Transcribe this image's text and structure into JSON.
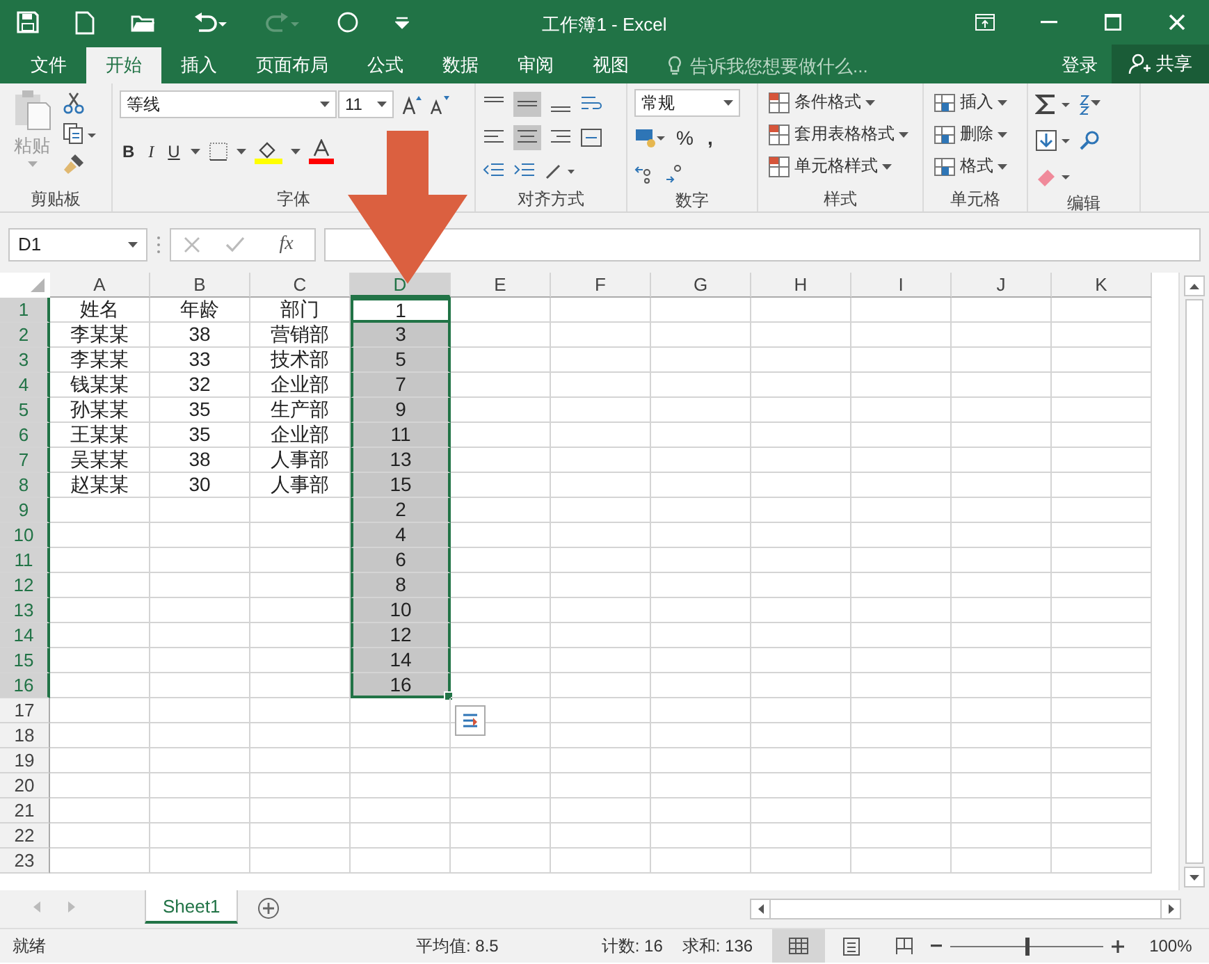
{
  "window": {
    "title": "工作簿1 - Excel"
  },
  "tabs": [
    {
      "label": "文件",
      "selected": false
    },
    {
      "label": "开始",
      "selected": true
    },
    {
      "label": "插入",
      "selected": false
    },
    {
      "label": "页面布局",
      "selected": false
    },
    {
      "label": "公式",
      "selected": false
    },
    {
      "label": "数据",
      "selected": false
    },
    {
      "label": "审阅",
      "selected": false
    },
    {
      "label": "视图",
      "selected": false
    }
  ],
  "tell_me": {
    "placeholder": "告诉我您想要做什么..."
  },
  "sign_in": "登录",
  "share": "共享",
  "ribbon": {
    "clipboard": {
      "paste": "粘贴",
      "label": "剪贴板"
    },
    "font": {
      "name": "等线",
      "size": "11",
      "bold": "B",
      "italic": "I",
      "underline": "U",
      "label": "字体"
    },
    "alignment": {
      "label": "对齐方式"
    },
    "number": {
      "format": "常规",
      "percent": "%",
      "comma": ",",
      "label": "数字"
    },
    "styles": {
      "items": [
        "条件格式",
        "套用表格格式",
        "单元格样式"
      ],
      "label": "样式"
    },
    "cells": {
      "items": [
        "插入",
        "删除",
        "格式"
      ],
      "label": "单元格"
    },
    "editing": {
      "label": "编辑"
    }
  },
  "formula_bar": {
    "name_box": "D1",
    "fx": "fx"
  },
  "columns": [
    {
      "label": "A",
      "selected": false
    },
    {
      "label": "B",
      "selected": false
    },
    {
      "label": "C",
      "selected": false
    },
    {
      "label": "D",
      "selected": true
    },
    {
      "label": "E",
      "selected": false
    },
    {
      "label": "F",
      "selected": false
    },
    {
      "label": "G",
      "selected": false
    },
    {
      "label": "H",
      "selected": false
    },
    {
      "label": "I",
      "selected": false
    },
    {
      "label": "J",
      "selected": false
    },
    {
      "label": "K",
      "selected": false
    }
  ],
  "rows": [
    {
      "number": "1",
      "selected": true,
      "active": true,
      "cells": [
        "姓名",
        "年龄",
        "部门",
        "1"
      ]
    },
    {
      "number": "2",
      "selected": true,
      "active": false,
      "cells": [
        "李某某",
        "38",
        "营销部",
        "3"
      ]
    },
    {
      "number": "3",
      "selected": true,
      "active": false,
      "cells": [
        "李某某",
        "33",
        "技术部",
        "5"
      ]
    },
    {
      "number": "4",
      "selected": true,
      "active": false,
      "cells": [
        "钱某某",
        "32",
        "企业部",
        "7"
      ]
    },
    {
      "number": "5",
      "selected": true,
      "active": false,
      "cells": [
        "孙某某",
        "35",
        "生产部",
        "9"
      ]
    },
    {
      "number": "6",
      "selected": true,
      "active": false,
      "cells": [
        "王某某",
        "35",
        "企业部",
        "11"
      ]
    },
    {
      "number": "7",
      "selected": true,
      "active": false,
      "cells": [
        "吴某某",
        "38",
        "人事部",
        "13"
      ]
    },
    {
      "number": "8",
      "selected": true,
      "active": false,
      "cells": [
        "赵某某",
        "30",
        "人事部",
        "15"
      ]
    },
    {
      "number": "9",
      "selected": true,
      "active": false,
      "cells": [
        "",
        "",
        "",
        "2"
      ]
    },
    {
      "number": "10",
      "selected": true,
      "active": false,
      "cells": [
        "",
        "",
        "",
        "4"
      ]
    },
    {
      "number": "11",
      "selected": true,
      "active": false,
      "cells": [
        "",
        "",
        "",
        "6"
      ]
    },
    {
      "number": "12",
      "selected": true,
      "active": false,
      "cells": [
        "",
        "",
        "",
        "8"
      ]
    },
    {
      "number": "13",
      "selected": true,
      "active": false,
      "cells": [
        "",
        "",
        "",
        "10"
      ]
    },
    {
      "number": "14",
      "selected": true,
      "active": false,
      "cells": [
        "",
        "",
        "",
        "12"
      ]
    },
    {
      "number": "15",
      "selected": true,
      "active": false,
      "cells": [
        "",
        "",
        "",
        "14"
      ]
    },
    {
      "number": "16",
      "selected": true,
      "active": false,
      "cells": [
        "",
        "",
        "",
        "16"
      ]
    },
    {
      "number": "17",
      "selected": false,
      "active": false
    },
    {
      "number": "18",
      "selected": false,
      "active": false
    },
    {
      "number": "19",
      "selected": false,
      "active": false
    },
    {
      "number": "20",
      "selected": false,
      "active": false
    },
    {
      "number": "21",
      "selected": false,
      "active": false
    },
    {
      "number": "22",
      "selected": false,
      "active": false
    },
    {
      "number": "23",
      "selected": false,
      "active": false
    }
  ],
  "sheet_tabs": [
    {
      "label": "Sheet1",
      "selected": true
    }
  ],
  "status_bar": {
    "state": "就绪",
    "average": "平均值: 8.5",
    "count": "计数: 16",
    "sum": "求和: 136",
    "zoom": "100%",
    "zoom_slider": {
      "level": 0.5
    }
  }
}
